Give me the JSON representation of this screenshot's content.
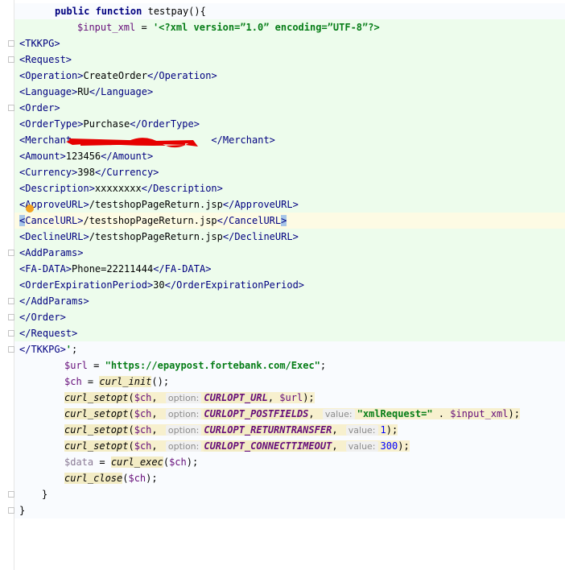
{
  "editor": {
    "lines": [
      {
        "kind": "raw",
        "cls": "bg-plain",
        "indent": 50,
        "segs": [
          [
            "kw",
            "public "
          ],
          [
            "kw",
            "function "
          ],
          [
            "plain",
            "testpay(){"
          ]
        ]
      },
      {
        "kind": "raw",
        "cls": "bg-green",
        "indent": 78,
        "segs": [
          [
            "var",
            "$input_xml"
          ],
          [
            "plain",
            " = "
          ],
          [
            "str",
            "'<?xml version=”1.0” encoding=”UTF-8”?>"
          ]
        ]
      },
      {
        "kind": "raw",
        "cls": "bg-green",
        "indent": 6,
        "segs": [
          [
            "tag",
            "<TKKPG>"
          ]
        ]
      },
      {
        "kind": "raw",
        "cls": "bg-green",
        "indent": 6,
        "segs": [
          [
            "tag",
            "<Request>"
          ]
        ]
      },
      {
        "kind": "raw",
        "cls": "bg-green",
        "indent": 6,
        "segs": [
          [
            "tag",
            "<Operation>"
          ],
          [
            "plain",
            "CreateOrder"
          ],
          [
            "tag",
            "</Operation>"
          ]
        ]
      },
      {
        "kind": "raw",
        "cls": "bg-green",
        "indent": 6,
        "segs": [
          [
            "tag",
            "<Language>"
          ],
          [
            "plain",
            "RU"
          ],
          [
            "tag",
            "</Language>"
          ]
        ]
      },
      {
        "kind": "raw",
        "cls": "bg-green",
        "indent": 6,
        "segs": [
          [
            "tag",
            "<Order>"
          ]
        ]
      },
      {
        "kind": "raw",
        "cls": "bg-green",
        "indent": 6,
        "segs": [
          [
            "tag",
            "<OrderType>"
          ],
          [
            "plain",
            "Purchase"
          ],
          [
            "tag",
            "</OrderType>"
          ]
        ]
      },
      {
        "kind": "raw",
        "cls": "bg-green",
        "indent": 6,
        "segs": [
          [
            "tag",
            "<Merchant"
          ],
          [
            "gap",
            "                        "
          ],
          [
            "tag",
            "</Merchant>"
          ]
        ]
      },
      {
        "kind": "raw",
        "cls": "bg-green",
        "indent": 6,
        "segs": [
          [
            "tag",
            "<Amount>"
          ],
          [
            "plain",
            "123456"
          ],
          [
            "tag",
            "</Amount>"
          ]
        ]
      },
      {
        "kind": "raw",
        "cls": "bg-green",
        "indent": 6,
        "segs": [
          [
            "tag",
            "<Currency>"
          ],
          [
            "plain",
            "398"
          ],
          [
            "tag",
            "</Currency>"
          ]
        ]
      },
      {
        "kind": "raw",
        "cls": "bg-green",
        "indent": 6,
        "segs": [
          [
            "tag",
            "<Description>"
          ],
          [
            "plain",
            "xxxxxxxx"
          ],
          [
            "tag",
            "</Description>"
          ]
        ]
      },
      {
        "kind": "raw",
        "cls": "bg-green",
        "indent": 6,
        "segs": [
          [
            "tag",
            "<ApproveURL>"
          ],
          [
            "plain",
            "/testshopPageReturn.jsp"
          ],
          [
            "tag",
            "</ApproveURL>"
          ]
        ]
      },
      {
        "kind": "raw",
        "cls": "bg-yellow",
        "indent": 6,
        "segs": [
          [
            "tagm",
            "<"
          ],
          [
            "tag",
            "CancelURL>"
          ],
          [
            "plain",
            "/testshopPageReturn.jsp"
          ],
          [
            "tag",
            "</CancelURL"
          ],
          [
            "tagm",
            ">"
          ]
        ]
      },
      {
        "kind": "raw",
        "cls": "bg-green",
        "indent": 6,
        "segs": [
          [
            "tag",
            "<DeclineURL>"
          ],
          [
            "plain",
            "/testshopPageReturn.jsp"
          ],
          [
            "tag",
            "</DeclineURL>"
          ]
        ]
      },
      {
        "kind": "raw",
        "cls": "bg-green",
        "indent": 6,
        "segs": [
          [
            "tag",
            "<AddParams>"
          ]
        ]
      },
      {
        "kind": "raw",
        "cls": "bg-green",
        "indent": 6,
        "segs": [
          [
            "tag",
            "<FA-DATA>"
          ],
          [
            "plain",
            "Phone=22211444"
          ],
          [
            "tag",
            "</FA-DATA>"
          ]
        ]
      },
      {
        "kind": "raw",
        "cls": "bg-green",
        "indent": 6,
        "segs": [
          [
            "tag",
            "<OrderExpirationPeriod>"
          ],
          [
            "plain",
            "30"
          ],
          [
            "tag",
            "</OrderExpirationPeriod>"
          ]
        ]
      },
      {
        "kind": "raw",
        "cls": "bg-green",
        "indent": 6,
        "segs": [
          [
            "tag",
            "</AddParams>"
          ]
        ]
      },
      {
        "kind": "raw",
        "cls": "bg-green",
        "indent": 6,
        "segs": [
          [
            "tag",
            "</Order>"
          ]
        ]
      },
      {
        "kind": "raw",
        "cls": "bg-green",
        "indent": 6,
        "segs": [
          [
            "tag",
            "</Request>"
          ]
        ]
      },
      {
        "kind": "raw",
        "cls": "bg-plain",
        "indent": 6,
        "segs": [
          [
            "tag",
            "</TKKPG>"
          ],
          [
            "str",
            "'"
          ],
          [
            "plain",
            ";"
          ]
        ]
      },
      {
        "kind": "raw",
        "cls": "bg-plain",
        "indent": 62,
        "segs": [
          [
            "var",
            "$url"
          ],
          [
            "plain",
            " = "
          ],
          [
            "str",
            "\"https://epaypost.fortebank.com/Exec\""
          ],
          [
            "plain",
            ";"
          ]
        ]
      },
      {
        "kind": "raw",
        "cls": "bg-plain",
        "indent": 62,
        "segs": [
          [
            "var",
            "$ch"
          ],
          [
            "plain",
            " = "
          ],
          [
            "fn",
            "curl_init"
          ],
          [
            "plain",
            "();"
          ]
        ]
      },
      {
        "kind": "raw",
        "cls": "bg-plain",
        "indent": 62,
        "segs": [
          [
            "fn",
            "curl_setopt"
          ],
          [
            "plain",
            "("
          ],
          [
            "var",
            "$ch"
          ],
          [
            "plain",
            ", "
          ],
          [
            "hint",
            "option:"
          ],
          [
            "const",
            "CURLOPT_URL"
          ],
          [
            "plain",
            ", "
          ],
          [
            "var",
            "$url"
          ],
          [
            "plain",
            ");"
          ]
        ]
      },
      {
        "kind": "raw",
        "cls": "bg-plain",
        "indent": 62,
        "segs": [
          [
            "fn",
            "curl_setopt"
          ],
          [
            "plain",
            "("
          ],
          [
            "var",
            "$ch"
          ],
          [
            "plain",
            ", "
          ],
          [
            "hint",
            "option:"
          ],
          [
            "const",
            "CURLOPT_POSTFIELDS"
          ],
          [
            "plain",
            ", "
          ],
          [
            "hint",
            "value:"
          ],
          [
            "str",
            "\"xmlRequest=\""
          ],
          [
            "plain",
            " . "
          ],
          [
            "var",
            "$input_xml"
          ],
          [
            "plain",
            ");"
          ]
        ]
      },
      {
        "kind": "raw",
        "cls": "bg-plain",
        "indent": 62,
        "segs": [
          [
            "fn",
            "curl_setopt"
          ],
          [
            "plain",
            "("
          ],
          [
            "var",
            "$ch"
          ],
          [
            "plain",
            ", "
          ],
          [
            "hint",
            "option:"
          ],
          [
            "const",
            "CURLOPT_RETURNTRANSFER"
          ],
          [
            "plain",
            ", "
          ],
          [
            "hint",
            "value:"
          ],
          [
            "num",
            "1"
          ],
          [
            "plain",
            ");"
          ]
        ]
      },
      {
        "kind": "raw",
        "cls": "bg-plain",
        "indent": 62,
        "segs": [
          [
            "fn",
            "curl_setopt"
          ],
          [
            "plain",
            "("
          ],
          [
            "var",
            "$ch"
          ],
          [
            "plain",
            ", "
          ],
          [
            "hint",
            "option:"
          ],
          [
            "const",
            "CURLOPT_CONNECTTIMEOUT"
          ],
          [
            "plain",
            ", "
          ],
          [
            "hint",
            "value:"
          ],
          [
            "num",
            "300"
          ],
          [
            "plain",
            ");"
          ]
        ]
      },
      {
        "kind": "raw",
        "cls": "bg-plain",
        "indent": 62,
        "segs": [
          [
            "var-dim",
            "$data"
          ],
          [
            "plain",
            " = "
          ],
          [
            "fn",
            "curl_exec"
          ],
          [
            "plain",
            "("
          ],
          [
            "var",
            "$ch"
          ],
          [
            "plain",
            ");"
          ]
        ]
      },
      {
        "kind": "raw",
        "cls": "bg-plain",
        "indent": 62,
        "segs": [
          [
            "fn",
            "curl_close"
          ],
          [
            "plain",
            "("
          ],
          [
            "var",
            "$ch"
          ],
          [
            "plain",
            ");"
          ]
        ]
      },
      {
        "kind": "raw",
        "cls": "bg-plain",
        "indent": 34,
        "segs": [
          [
            "plain",
            "}"
          ]
        ]
      },
      {
        "kind": "raw",
        "cls": "bg-plain",
        "indent": 6,
        "segs": [
          [
            "plain",
            "}"
          ]
        ]
      }
    ],
    "fold_rows": [
      2,
      3,
      6,
      15,
      18,
      19,
      20,
      21,
      30,
      31
    ]
  }
}
